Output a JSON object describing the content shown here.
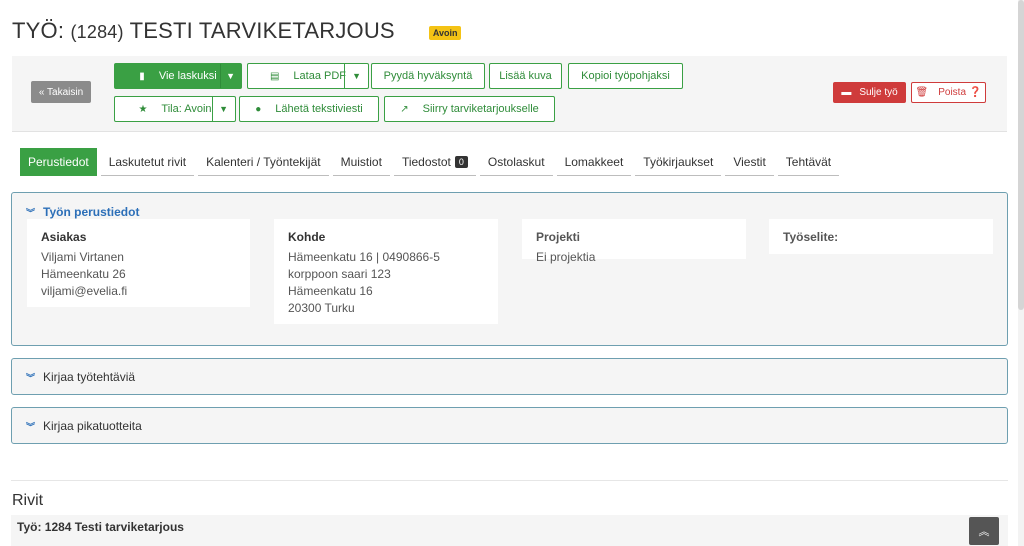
{
  "header": {
    "title_prefix": "TYÖ: ",
    "job_number": "(1284)",
    "job_name": " TESTI TARVIKETARJOUS",
    "status_badge": "Avoin"
  },
  "toolbar": {
    "back": "« Takaisin",
    "invoice": "Vie laskuksi",
    "pdf": "Lataa PDF",
    "approval": "Pyydä hyväksyntä",
    "add_image": "Lisää kuva",
    "copy_template": "Kopioi työpohjaksi",
    "status": "Tila: Avoin",
    "sms": "Lähetä tekstiviesti",
    "move": "Siirry tarviketarjoukselle",
    "close": "Sulje työ",
    "delete": "Poista"
  },
  "tabs": [
    {
      "label": "Perustiedot"
    },
    {
      "label": "Laskutetut rivit"
    },
    {
      "label": "Kalenteri / Työntekijät"
    },
    {
      "label": "Muistiot"
    },
    {
      "label": "Tiedostot",
      "count": "0"
    },
    {
      "label": "Ostolaskut"
    },
    {
      "label": "Lomakkeet"
    },
    {
      "label": "Työkirjaukset"
    },
    {
      "label": "Viestit"
    },
    {
      "label": "Tehtävät"
    }
  ],
  "basic_info": {
    "title": "Työn perustiedot",
    "customer": {
      "label": "Asiakas",
      "lines": [
        "Viljami Virtanen",
        "Hämeenkatu 26",
        "viljami@evelia.fi"
      ]
    },
    "target": {
      "label": "Kohde",
      "lines": [
        "Hämeenkatu 16 | 0490866-5",
        "korppoon saari 123",
        "Hämeenkatu 16",
        "20300 Turku"
      ]
    },
    "project": {
      "label": "Projekti",
      "lines": [
        "Ei projektia"
      ]
    },
    "description": {
      "label": "Työselite:"
    }
  },
  "sections": {
    "tasks": "Kirjaa työtehtäviä",
    "quick_products": "Kirjaa pikatuotteita"
  },
  "rows": {
    "title": "Rivit",
    "job_line": "Työ: 1284 Testi tarviketarjous"
  },
  "colors": {
    "green": "#3aa044",
    "red": "#cf3b3b",
    "blue": "#2c6fb8",
    "badge": "#f4c315"
  }
}
